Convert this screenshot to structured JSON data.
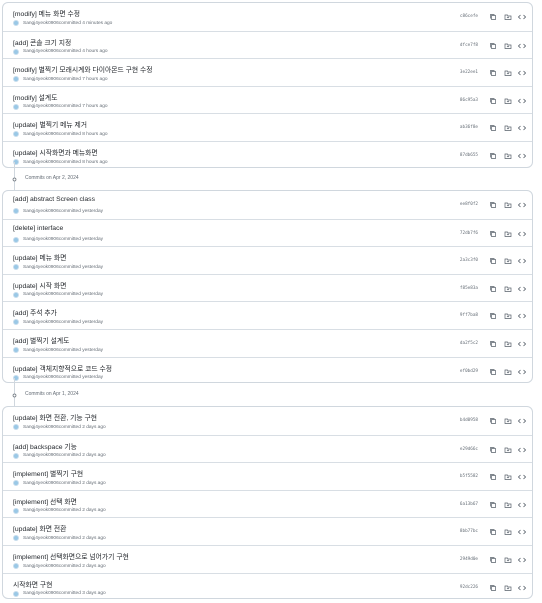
{
  "sections": [
    {
      "header": "",
      "commits": [
        {
          "title": "[modify] 메뉴 화면 수정",
          "author": "Sangj4yeok0906",
          "time": "committed 4 minutes ago",
          "sha": "c86cefe"
        },
        {
          "title": "[add] 콘솔 크기 지정",
          "author": "Sangj4yeok0906",
          "time": "committed 4 hours ago",
          "sha": "dfce7f8"
        },
        {
          "title": "[modify] 별찍기 모래시계와 다이아몬드 구현 수정",
          "author": "Sangj4yeok0906",
          "time": "committed 7 hours ago",
          "sha": "3e22ee1"
        },
        {
          "title": "[modify] 설계도",
          "author": "Sangj4yeok0906",
          "time": "committed 7 hours ago",
          "sha": "86c95a3"
        },
        {
          "title": "[update] 별찍기 메뉴 제거",
          "author": "Sangj4yeok0906",
          "time": "committed 8 hours ago",
          "sha": "ab36f8e"
        },
        {
          "title": "[update] 시작화면과 메뉴화면",
          "author": "Sangj4yeok0906",
          "time": "committed 8 hours ago",
          "sha": "87db655"
        }
      ]
    },
    {
      "header": "Commits on Apr 2, 2024",
      "commits": [
        {
          "title": "[add] abstract Screen class",
          "author": "Sangj4yeok0906",
          "time": "committed yesterday",
          "sha": "ee8f0f2"
        },
        {
          "title": "[delete] interface",
          "author": "Sangj4yeok0906",
          "time": "committed yesterday",
          "sha": "72db7f6"
        },
        {
          "title": "[update] 메뉴 화면",
          "author": "Sangj4yeok0906",
          "time": "committed yesterday",
          "sha": "2a3c3f0"
        },
        {
          "title": "[update] 시작 화면",
          "author": "Sangj4yeok0906",
          "time": "committed yesterday",
          "sha": "f85e83a"
        },
        {
          "title": "[add] 주석 추가",
          "author": "Sangj4yeok0906",
          "time": "committed yesterday",
          "sha": "9ff7ba8"
        },
        {
          "title": "[add] 별찍기 설계도",
          "author": "Sangj4yeok0906",
          "time": "committed yesterday",
          "sha": "da2f5c2"
        },
        {
          "title": "[update] 객체지향적으로 코드 수정",
          "author": "Sangj4yeok0906",
          "time": "committed yesterday",
          "sha": "ef0bd29"
        }
      ]
    },
    {
      "header": "Commits on Apr 1, 2024",
      "commits": [
        {
          "title": "[update] 화면 전환, 기능 구현",
          "author": "Sangj4yeok0906",
          "time": "committed 2 days ago",
          "sha": "b4d0958"
        },
        {
          "title": "[add] backspace 기능",
          "author": "Sangj4yeok0906",
          "time": "committed 2 days ago",
          "sha": "e29d66c"
        },
        {
          "title": "[implement] 별찍기 구현",
          "author": "Sangj4yeok0906",
          "time": "committed 2 days ago",
          "sha": "b5f5582"
        },
        {
          "title": "[implement] 선택 화면",
          "author": "Sangj4yeok0906",
          "time": "committed 2 days ago",
          "sha": "6a13b67"
        },
        {
          "title": "[update] 화면 전환",
          "author": "Sangj4yeok0906",
          "time": "committed 2 days ago",
          "sha": "8bb77bc"
        },
        {
          "title": "[implement] 선택화면으로 넘어가기 구현",
          "author": "Sangj4yeok0906",
          "time": "committed 2 days ago",
          "sha": "2949d0e"
        },
        {
          "title": "시작화면 구현",
          "author": "Sangj4yeok0906",
          "time": "committed 3 days ago",
          "sha": "92dc226"
        }
      ]
    }
  ],
  "icons": {
    "copy": "copy-icon",
    "browse": "browse-files-icon",
    "code": "code-icon",
    "commit": "git-commit-icon"
  },
  "colors": {
    "border": "#d0d7de",
    "muted": "#656d76",
    "text": "#1f2328",
    "avatar": "#9ac8e6"
  }
}
